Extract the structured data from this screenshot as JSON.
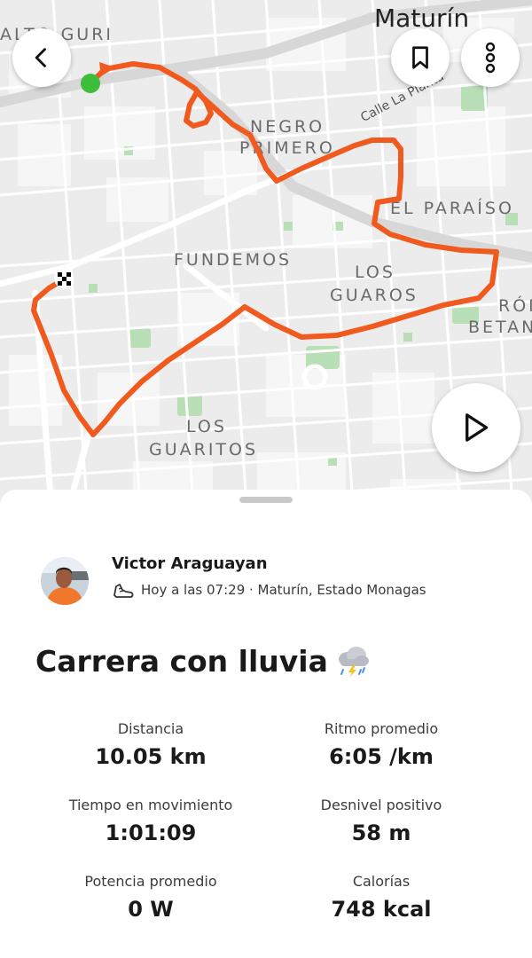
{
  "map": {
    "city": "Maturín",
    "street": "Calle La Planta",
    "neighborhoods": [
      {
        "key": "alto",
        "text": "ALTO GURI"
      },
      {
        "key": "negro1",
        "text": "NEGRO"
      },
      {
        "key": "negro2",
        "text": "PRIMERO"
      },
      {
        "key": "paraiso",
        "text": "EL PARAÍSO"
      },
      {
        "key": "fundemos",
        "text": "FUNDEMOS"
      },
      {
        "key": "losg1",
        "text": "LOS"
      },
      {
        "key": "losg2",
        "text": "GUAROS"
      },
      {
        "key": "ron1",
        "text": "RÓM"
      },
      {
        "key": "ron2",
        "text": "BETAN"
      },
      {
        "key": "guar1",
        "text": "LOS"
      },
      {
        "key": "guar2",
        "text": "GUARITOS"
      }
    ],
    "route_color": "#F05A1E",
    "start_color": "#3DBE3A"
  },
  "toolbar": {
    "back_icon": "chevron-left-icon",
    "bookmark_icon": "bookmark-icon",
    "more_icon": "vertical-dots-icon",
    "play_icon": "play-icon"
  },
  "activity": {
    "athlete_name": "Victor Araguayan",
    "meta": "Hoy a las 07:29 · Maturín, Estado Monagas",
    "sport_icon": "running-shoe-icon",
    "title": "Carrera con lluvia",
    "weather_icon": "thunderstorm-cloud-icon"
  },
  "stats": [
    {
      "label": "Distancia",
      "value": "10.05 km"
    },
    {
      "label": "Ritmo promedio",
      "value": "6:05 /km"
    },
    {
      "label": "Tiempo en movimiento",
      "value": "1:01:09"
    },
    {
      "label": "Desnivel positivo",
      "value": "58 m"
    },
    {
      "label": "Potencia promedio",
      "value": "0 W"
    },
    {
      "label": "Calorías",
      "value": "748 kcal"
    }
  ]
}
